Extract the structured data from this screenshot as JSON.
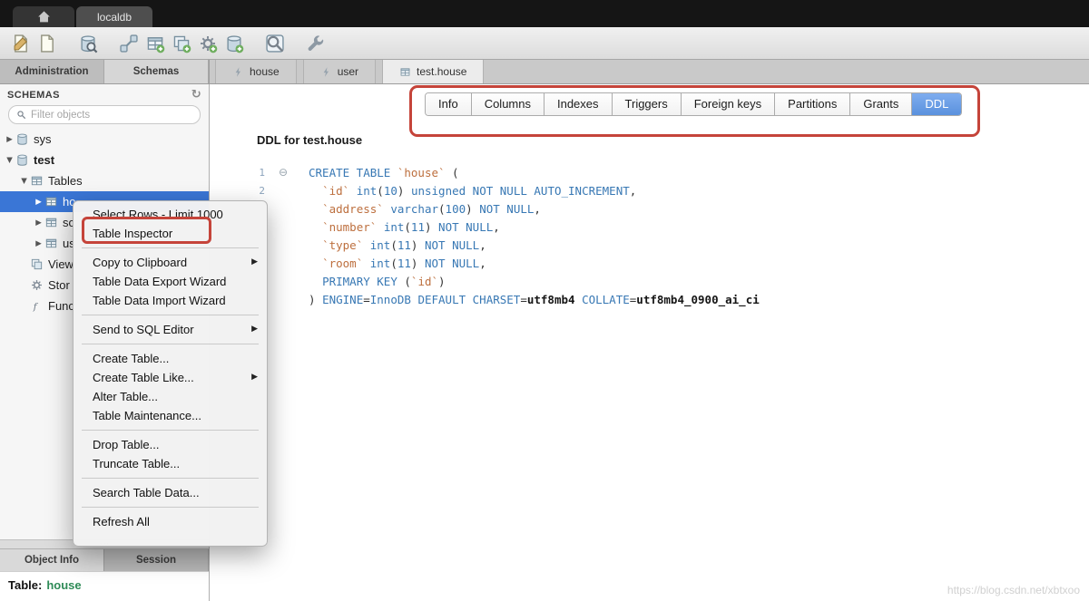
{
  "colors": {
    "annotation_red": "#c5443a",
    "active_tab_blue": "#5a91dd",
    "selection_blue": "#3a76d6",
    "keyword_blue": "#3878b4",
    "identifier_orange": "#bd6f3e",
    "schema_green": "#2e8b57"
  },
  "titlebar": {
    "connection_tab": "localdb"
  },
  "toolbar": {
    "groups": [
      {
        "icons": [
          {
            "name": "new-sql-editor",
            "type": "doc-edit"
          },
          {
            "name": "open-sql-file",
            "type": "doc"
          }
        ]
      },
      {
        "icons": [
          {
            "name": "table-inspector",
            "type": "db-search"
          }
        ]
      },
      {
        "icons": [
          {
            "name": "new-connection",
            "type": "db-link"
          },
          {
            "name": "new-table",
            "type": "table-add"
          },
          {
            "name": "new-view",
            "type": "view-add"
          },
          {
            "name": "new-routine",
            "type": "gear-add"
          },
          {
            "name": "new-schema",
            "type": "db-add"
          }
        ]
      },
      {
        "icons": [
          {
            "name": "search-objects",
            "type": "search-box"
          }
        ]
      },
      {
        "icons": [
          {
            "name": "tools",
            "type": "wrench"
          }
        ]
      }
    ]
  },
  "side_tabs": [
    {
      "label": "Administration",
      "active": false
    },
    {
      "label": "Schemas",
      "active": true
    }
  ],
  "editor_tabs": [
    {
      "label": "house",
      "icon": "bolt",
      "active": false
    },
    {
      "label": "user",
      "icon": "bolt",
      "active": false
    },
    {
      "label": "test.house",
      "icon": "table",
      "active": true
    }
  ],
  "schemas_panel": {
    "title": "SCHEMAS",
    "filter_placeholder": "Filter objects",
    "tree": [
      {
        "label": "sys",
        "level": 0,
        "icon": "db",
        "arrow": "collapsed",
        "bold": false,
        "selected": false
      },
      {
        "label": "test",
        "level": 0,
        "icon": "db",
        "arrow": "expanded",
        "bold": true,
        "selected": false
      },
      {
        "label": "Tables",
        "level": 1,
        "icon": "tables",
        "arrow": "expanded",
        "bold": false,
        "selected": false
      },
      {
        "label": "ho",
        "level": 2,
        "icon": "table",
        "arrow": "collapsed",
        "bold": false,
        "selected": true
      },
      {
        "label": "sc",
        "level": 2,
        "icon": "table",
        "arrow": "collapsed",
        "bold": false,
        "selected": false
      },
      {
        "label": "us",
        "level": 2,
        "icon": "table",
        "arrow": "collapsed",
        "bold": false,
        "selected": false
      },
      {
        "label": "View",
        "level": 1,
        "icon": "view",
        "arrow": "none",
        "bold": false,
        "selected": false
      },
      {
        "label": "Stor",
        "level": 1,
        "icon": "gear",
        "arrow": "none",
        "bold": false,
        "selected": false
      },
      {
        "label": "Func",
        "level": 1,
        "icon": "func",
        "arrow": "none",
        "bold": false,
        "selected": false
      }
    ]
  },
  "context_menu": {
    "groups": [
      {
        "items": [
          {
            "label": "Select Rows - Limit 1000",
            "submenu": false,
            "highlighted": false
          },
          {
            "label": "Table Inspector",
            "submenu": false,
            "highlighted": true
          }
        ]
      },
      {
        "items": [
          {
            "label": "Copy to Clipboard",
            "submenu": true,
            "highlighted": false
          },
          {
            "label": "Table Data Export Wizard",
            "submenu": false,
            "highlighted": false
          },
          {
            "label": "Table Data Import Wizard",
            "submenu": false,
            "highlighted": false
          }
        ]
      },
      {
        "items": [
          {
            "label": "Send to SQL Editor",
            "submenu": true,
            "highlighted": false
          }
        ]
      },
      {
        "items": [
          {
            "label": "Create Table...",
            "submenu": false,
            "highlighted": false
          },
          {
            "label": "Create Table Like...",
            "submenu": true,
            "highlighted": false
          },
          {
            "label": "Alter Table...",
            "submenu": false,
            "highlighted": false
          },
          {
            "label": "Table Maintenance...",
            "submenu": false,
            "highlighted": false
          }
        ]
      },
      {
        "items": [
          {
            "label": "Drop Table...",
            "submenu": false,
            "highlighted": false
          },
          {
            "label": "Truncate Table...",
            "submenu": false,
            "highlighted": false
          }
        ]
      },
      {
        "items": [
          {
            "label": "Search Table Data...",
            "submenu": false,
            "highlighted": false
          }
        ]
      },
      {
        "items": [
          {
            "label": "Refresh All",
            "submenu": false,
            "highlighted": false
          }
        ]
      }
    ]
  },
  "main": {
    "tabs": [
      {
        "label": "Info",
        "active": false
      },
      {
        "label": "Columns",
        "active": false
      },
      {
        "label": "Indexes",
        "active": false
      },
      {
        "label": "Triggers",
        "active": false
      },
      {
        "label": "Foreign keys",
        "active": false
      },
      {
        "label": "Partitions",
        "active": false
      },
      {
        "label": "Grants",
        "active": false
      },
      {
        "label": "DDL",
        "active": true
      }
    ],
    "ddl_header": "DDL for test.house",
    "code_lines": [
      {
        "num": "1",
        "fold": true,
        "segments": [
          {
            "t": "CREATE TABLE ",
            "c": "k"
          },
          {
            "t": "`house`",
            "c": "i"
          },
          {
            "t": " (",
            "c": "p"
          }
        ]
      },
      {
        "num": "2",
        "fold": false,
        "segments": [
          {
            "t": "  ",
            "c": "p"
          },
          {
            "t": "`id`",
            "c": "i"
          },
          {
            "t": " ",
            "c": "p"
          },
          {
            "t": "int",
            "c": "k"
          },
          {
            "t": "(",
            "c": "p"
          },
          {
            "t": "10",
            "c": "n"
          },
          {
            "t": ") ",
            "c": "p"
          },
          {
            "t": "unsigned NOT NULL AUTO_INCREMENT",
            "c": "k"
          },
          {
            "t": ",",
            "c": "p"
          }
        ]
      },
      {
        "num": "",
        "fold": false,
        "segments": [
          {
            "t": "  ",
            "c": "p"
          },
          {
            "t": "`address`",
            "c": "i"
          },
          {
            "t": " ",
            "c": "p"
          },
          {
            "t": "varchar",
            "c": "k"
          },
          {
            "t": "(",
            "c": "p"
          },
          {
            "t": "100",
            "c": "n"
          },
          {
            "t": ") ",
            "c": "p"
          },
          {
            "t": "NOT NULL",
            "c": "k"
          },
          {
            "t": ",",
            "c": "p"
          }
        ]
      },
      {
        "num": "",
        "fold": false,
        "segments": [
          {
            "t": "  ",
            "c": "p"
          },
          {
            "t": "`number`",
            "c": "i"
          },
          {
            "t": " ",
            "c": "p"
          },
          {
            "t": "int",
            "c": "k"
          },
          {
            "t": "(",
            "c": "p"
          },
          {
            "t": "11",
            "c": "n"
          },
          {
            "t": ") ",
            "c": "p"
          },
          {
            "t": "NOT NULL",
            "c": "k"
          },
          {
            "t": ",",
            "c": "p"
          }
        ]
      },
      {
        "num": "",
        "fold": false,
        "segments": [
          {
            "t": "  ",
            "c": "p"
          },
          {
            "t": "`type`",
            "c": "i"
          },
          {
            "t": " ",
            "c": "p"
          },
          {
            "t": "int",
            "c": "k"
          },
          {
            "t": "(",
            "c": "p"
          },
          {
            "t": "11",
            "c": "n"
          },
          {
            "t": ") ",
            "c": "p"
          },
          {
            "t": "NOT NULL",
            "c": "k"
          },
          {
            "t": ",",
            "c": "p"
          }
        ]
      },
      {
        "num": "",
        "fold": false,
        "segments": [
          {
            "t": "  ",
            "c": "p"
          },
          {
            "t": "`room`",
            "c": "i"
          },
          {
            "t": " ",
            "c": "p"
          },
          {
            "t": "int",
            "c": "k"
          },
          {
            "t": "(",
            "c": "p"
          },
          {
            "t": "11",
            "c": "n"
          },
          {
            "t": ") ",
            "c": "p"
          },
          {
            "t": "NOT NULL",
            "c": "k"
          },
          {
            "t": ",",
            "c": "p"
          }
        ]
      },
      {
        "num": "",
        "fold": false,
        "segments": [
          {
            "t": "  ",
            "c": "p"
          },
          {
            "t": "PRIMARY KEY",
            "c": "k"
          },
          {
            "t": " (",
            "c": "p"
          },
          {
            "t": "`id`",
            "c": "i"
          },
          {
            "t": ")",
            "c": "p"
          }
        ]
      },
      {
        "num": "",
        "fold": false,
        "segments": [
          {
            "t": ") ",
            "c": "p"
          },
          {
            "t": "ENGINE",
            "c": "k"
          },
          {
            "t": "=",
            "c": "p"
          },
          {
            "t": "InnoDB",
            "c": "k"
          },
          {
            "t": " ",
            "c": "p"
          },
          {
            "t": "DEFAULT CHARSET",
            "c": "k"
          },
          {
            "t": "=",
            "c": "p"
          },
          {
            "t": "utf8mb4",
            "c": "v"
          },
          {
            "t": " ",
            "c": "p"
          },
          {
            "t": "COLLATE",
            "c": "k"
          },
          {
            "t": "=",
            "c": "p"
          },
          {
            "t": "utf8mb4_0900_ai_ci",
            "c": "v"
          }
        ]
      }
    ]
  },
  "bottom_panel": {
    "tabs": [
      {
        "label": "Object Info",
        "active": true
      },
      {
        "label": "Session",
        "active": false
      }
    ],
    "object_label": "Table:",
    "object_value": "house"
  },
  "watermark": "https://blog.csdn.net/xbtxoo"
}
